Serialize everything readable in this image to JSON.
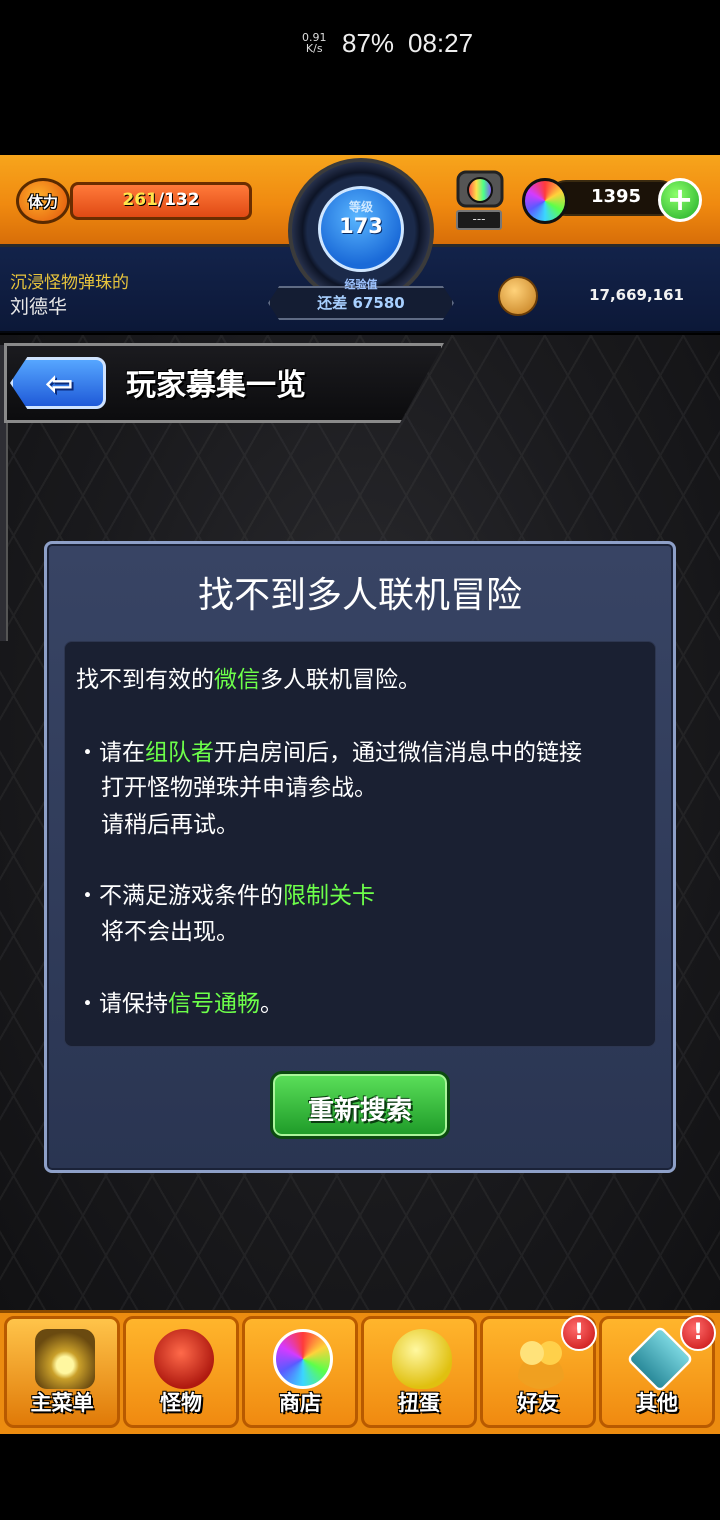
{
  "status_bar": {
    "speed_value": "0.91",
    "speed_unit": "K/s",
    "battery": "87%",
    "time": "08:27"
  },
  "header": {
    "stamina_label": "体力",
    "stamina_current": "261",
    "stamina_max": "/132",
    "stamina_fill_fraction": 1.0,
    "level_label": "等级",
    "level_value": "173",
    "exp_label": "经验值",
    "exp_remaining": "还差 67580",
    "chest_label": "---",
    "orb_count": "1395",
    "orb_add_symbol": "+",
    "player_subtitle": "沉浸怪物弹珠的",
    "player_name": "刘德华",
    "gold_count": "17,669,161"
  },
  "page": {
    "back_symbol": "⇦",
    "title": "玩家募集一览"
  },
  "dialog": {
    "title": "找不到多人联机冒险",
    "line1_a": "找不到有效的",
    "line1_hl": "微信",
    "line1_b": "多人联机冒险。",
    "line2_a": "・请在",
    "line2_hl": "组队者",
    "line2_b": "开启房间后，通过微信消息中的链接",
    "line3": "打开怪物弹珠并申请参战。",
    "line4": "请稍后再试。",
    "line5_a": "・不满足游戏条件的",
    "line5_hl": "限制关卡",
    "line6": "将不会出现。",
    "line7_a": "・请保持",
    "line7_hl": "信号通畅",
    "line7_b": "。",
    "retry_button": "重新搜索"
  },
  "bottom_nav": {
    "items": [
      {
        "label": "主菜单",
        "icon": "castle-gate-icon",
        "active": true
      },
      {
        "label": "怪物",
        "icon": "monster-icon"
      },
      {
        "label": "商店",
        "icon": "rainbow-orb-icon"
      },
      {
        "label": "扭蛋",
        "icon": "gacha-egg-icon"
      },
      {
        "label": "好友",
        "icon": "friends-icon",
        "alert": "!"
      },
      {
        "label": "其他",
        "icon": "other-icon",
        "alert": "!"
      }
    ]
  },
  "colors": {
    "highlight_green": "#6dff4a",
    "header_orange": "#f08a10",
    "header_navy": "#13234a",
    "dialog_bg": "#2a3552",
    "retry_green": "#1e9a28"
  }
}
